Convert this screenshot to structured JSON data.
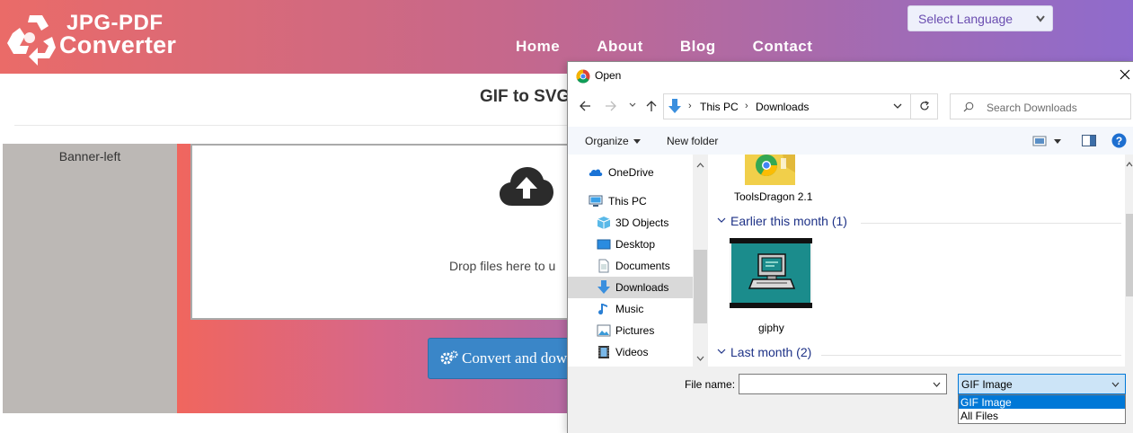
{
  "site": {
    "logo": {
      "line1": "JPG-PDF",
      "line2": "Converter"
    },
    "nav": [
      "Home",
      "About",
      "Blog",
      "Contact"
    ],
    "language_select": "Select Language",
    "page_title": "GIF to SVG",
    "banner_left": "Banner-left",
    "drop_text": "Drop files here to u",
    "convert_button": "Convert and download"
  },
  "dialog": {
    "title": "Open",
    "address": {
      "segments": [
        "This PC",
        "Downloads"
      ]
    },
    "search_placeholder": "Search Downloads",
    "toolbar": {
      "organize": "Organize",
      "new_folder": "New folder"
    },
    "nav_items": [
      {
        "label": "OneDrive",
        "icon": "onedrive-icon"
      },
      {
        "label": "This PC",
        "icon": "this-pc-icon"
      },
      {
        "label": "3D Objects",
        "icon": "3d-objects-icon"
      },
      {
        "label": "Desktop",
        "icon": "desktop-icon"
      },
      {
        "label": "Documents",
        "icon": "documents-icon"
      },
      {
        "label": "Downloads",
        "icon": "downloads-icon"
      },
      {
        "label": "Music",
        "icon": "music-icon"
      },
      {
        "label": "Pictures",
        "icon": "pictures-icon"
      },
      {
        "label": "Videos",
        "icon": "videos-icon"
      }
    ],
    "files": {
      "top_item": "ToolsDragon 2.1",
      "group_earlier": "Earlier this month (1)",
      "gif_item": "giphy",
      "group_last": "Last month (2)"
    },
    "footer": {
      "file_name_label": "File name:",
      "file_name_value": "",
      "file_type_selected": "GIF Image",
      "file_type_options": [
        "GIF Image",
        "All Files"
      ]
    }
  },
  "colors": {
    "accent_blue": "#0078d7",
    "header_start": "#ea6b68",
    "header_end": "#8f6bcc",
    "button_blue": "#3a86c8"
  }
}
